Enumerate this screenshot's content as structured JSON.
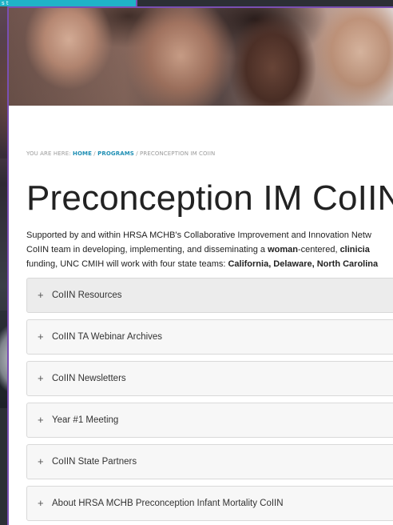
{
  "background_window": {
    "strip_text": "s t"
  },
  "breadcrumb": {
    "prefix": "YOU ARE HERE: ",
    "home": "HOME",
    "sep1": " / ",
    "programs": "PROGRAMS",
    "sep2": " / ",
    "current": "PRECONCEPTION IM COIIN"
  },
  "page": {
    "title": "Preconception IM CoIIN",
    "intro_line1": "Supported by and within HRSA MCHB's Collaborative Improvement and Innovation Netw",
    "intro_line2_a": "CoIIN team in developing, implementing, and disseminating a ",
    "intro_line2_bold1": "woman",
    "intro_line2_b": "-centered, ",
    "intro_line2_bold2": "clinicia",
    "intro_line3_a": "funding, UNC CMIH will work with four state teams: ",
    "intro_line3_bold": "California, Delaware, North Carolina"
  },
  "accordion": [
    {
      "label": "CoIIN Resources"
    },
    {
      "label": "CoIIN TA Webinar Archives"
    },
    {
      "label": "CoIIN Newsletters"
    },
    {
      "label": "Year #1 Meeting"
    },
    {
      "label": "CoIIN State Partners"
    },
    {
      "label": "About HRSA MCHB Preconception Infant Mortality CoIIN"
    }
  ],
  "icons": {
    "expand": "+"
  },
  "colors": {
    "link": "#1f8fb4",
    "window_border": "#7a4fb3",
    "teal_strip": "#1fb3c8"
  }
}
